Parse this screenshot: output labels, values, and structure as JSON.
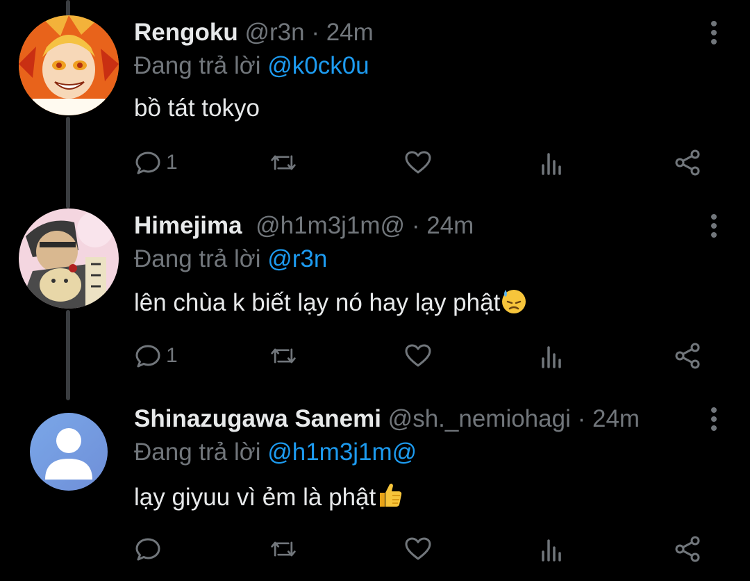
{
  "tweets": [
    {
      "name": "Rengoku",
      "handle": "@r3n",
      "time": "· 24m",
      "reply_prefix": "Đang trả lời",
      "reply_to": "@k0ck0u",
      "text": "bồ tát tokyo",
      "reply_count": "1",
      "avatar_icon": "anime-avatar-rengoku"
    },
    {
      "name": "Himejima",
      "handle": "@h1m3j1m@",
      "time": "· 24m",
      "reply_prefix": "Đang trả lời",
      "reply_to": "@r3n",
      "text": "lên chùa k biết lạy nó hay lạy phật",
      "emoji": "downcast-face-with-sweat",
      "reply_count": "1",
      "avatar_icon": "anime-avatar-himejima"
    },
    {
      "name": "Shinazugawa Sanemi",
      "handle": "@sh._nemiohagi",
      "time": "· 24m",
      "reply_prefix": "Đang trả lời",
      "reply_to": "@h1m3j1m@",
      "text": "lạy giyuu vì ẻm là phật",
      "emoji": "thumbs-up",
      "reply_count": "",
      "avatar_icon": "default-user-avatar"
    }
  ],
  "colors": {
    "background": "#000000",
    "text": "#e7e9ea",
    "muted": "#71767b",
    "mention": "#1d9bf0",
    "thread_line": "#3a3d40"
  }
}
